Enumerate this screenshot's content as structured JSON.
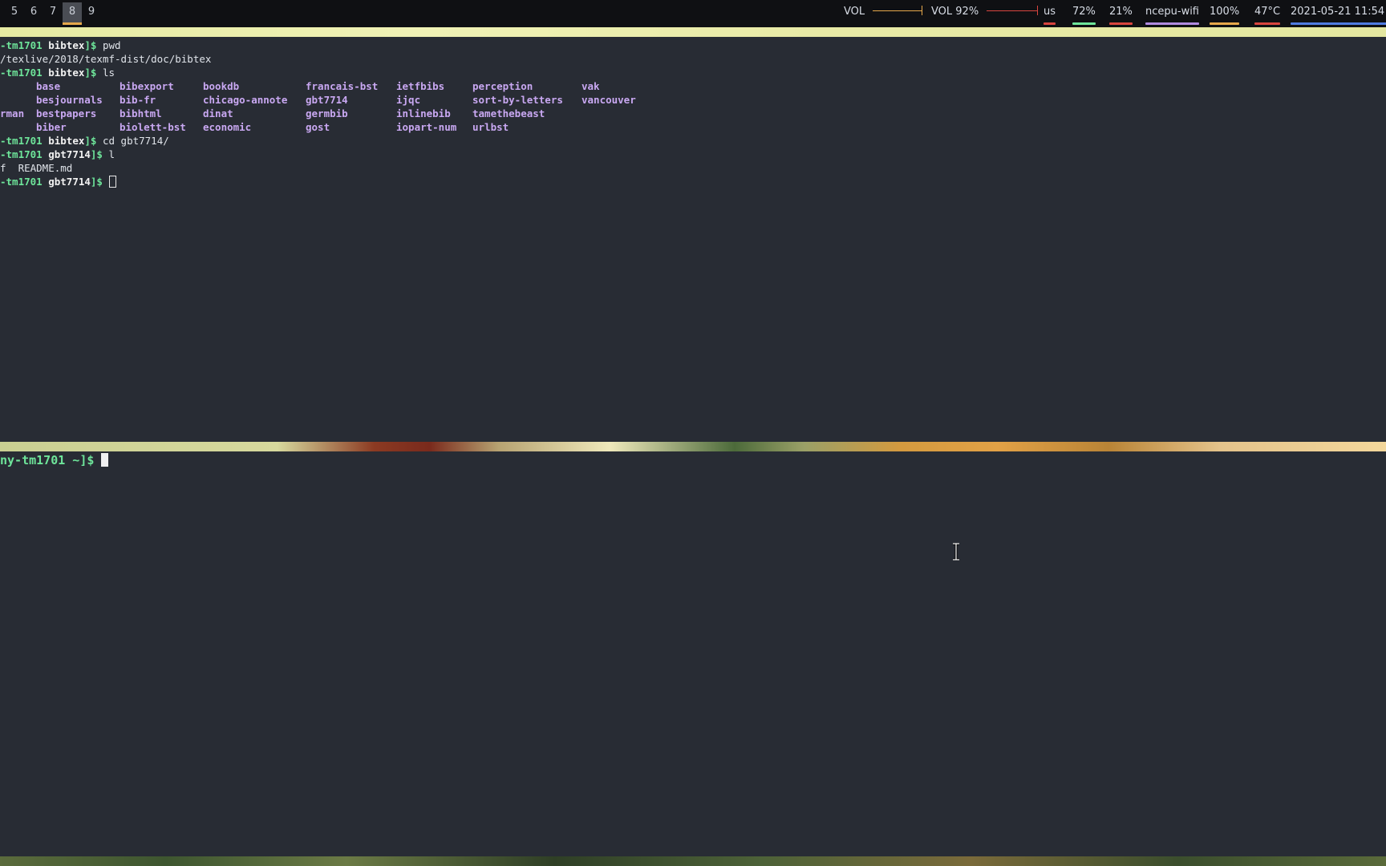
{
  "workspaces": [
    {
      "label": "5",
      "active": false
    },
    {
      "label": "6",
      "active": false
    },
    {
      "label": "7",
      "active": false
    },
    {
      "label": "8",
      "active": true
    },
    {
      "label": "9",
      "active": false
    }
  ],
  "status": {
    "vol1_label": "VOL",
    "vol2_label": "VOL 92%",
    "keyboard": "us",
    "cpu": "72%",
    "mem": "21%",
    "wifi": "ncepu-wifi",
    "battery": "100%",
    "temp": "47°C",
    "datetime": "2021-05-21 11:54",
    "colors": {
      "vol1": "#e5a84b",
      "vol2": "#d8453f",
      "keyboard": "#d8453f",
      "cpu": "#6ee59a",
      "mem": "#d8453f",
      "wifi": "#b08ae0",
      "battery": "#e5a84b",
      "temp": "#d8453f",
      "datetime": "#4f7be0"
    }
  },
  "top_terminal": {
    "l1_user": "-tm1701",
    "l1_dir": "bibtex",
    "l1_close": "]$",
    "l1_cmd": " pwd",
    "l2": "/texlive/2018/texmf-dist/doc/bibtex",
    "l3_user": "-tm1701",
    "l3_dir": "bibtex",
    "l3_close": "]$",
    "l3_cmd": " ls",
    "ls": [
      [
        "",
        "base",
        "bibexport",
        "bookdb",
        "francais-bst",
        "ietfbibs",
        "perception",
        "vak"
      ],
      [
        "",
        "besjournals",
        "bib-fr",
        "chicago-annote",
        "gbt7714",
        "ijqc",
        "sort-by-letters",
        "vancouver"
      ],
      [
        "rman",
        "bestpapers",
        "bibhtml",
        "dinat",
        "germbib",
        "inlinebib",
        "tamethebeast",
        ""
      ],
      [
        "",
        "biber",
        "biolett-bst",
        "economic",
        "gost",
        "iopart-num",
        "urlbst",
        ""
      ]
    ],
    "l8_user": "-tm1701",
    "l8_dir": "bibtex",
    "l8_close": "]$",
    "l8_cmd": " cd gbt7714/",
    "l9_user": "-tm1701",
    "l9_dir": "gbt7714",
    "l9_close": "]$",
    "l9_cmd": " l",
    "l10": "f  README.md",
    "l11_user": "-tm1701",
    "l11_dir": "gbt7714",
    "l11_close": "]$"
  },
  "bottom_terminal": {
    "prompt": "ny-tm1701 ~]$ "
  }
}
